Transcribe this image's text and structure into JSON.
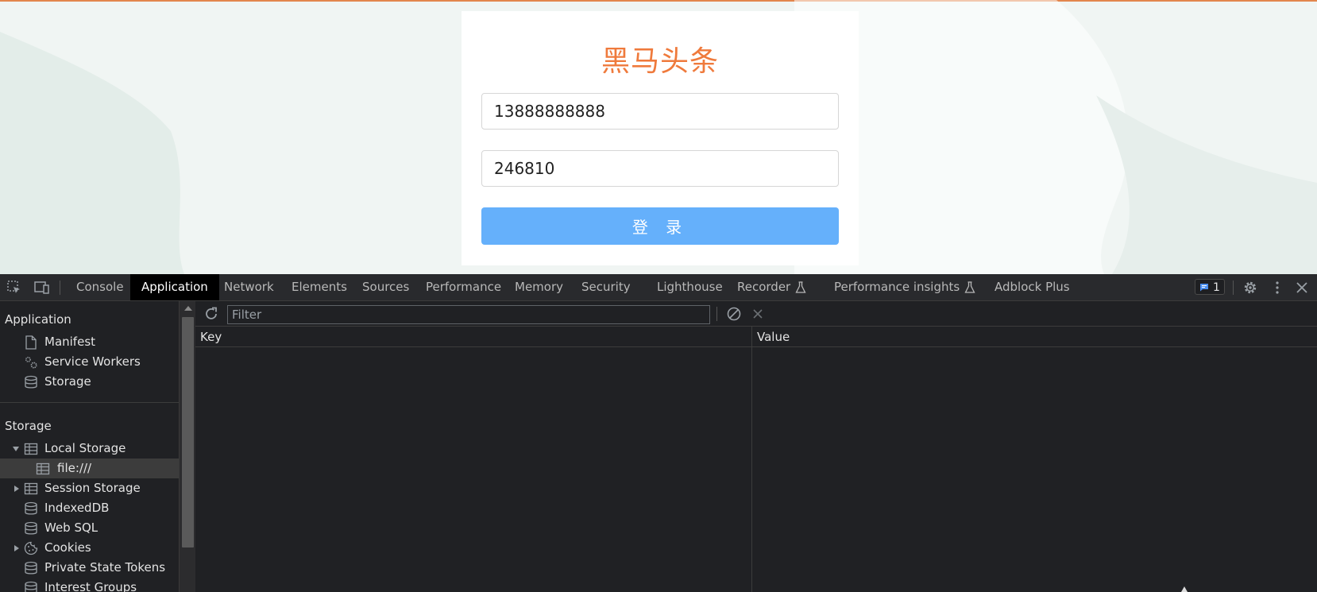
{
  "page": {
    "brand_color": "#ef7a3c",
    "title": "黑马头条",
    "phone_value": "13888888888",
    "code_value": "246810",
    "login_label": "登 录",
    "login_button_color": "#65b0fb"
  },
  "devtools": {
    "tabs": [
      {
        "label": "Console"
      },
      {
        "label": "Application"
      },
      {
        "label": "Network"
      },
      {
        "label": "Elements"
      },
      {
        "label": "Sources"
      },
      {
        "label": "Performance"
      },
      {
        "label": "Memory"
      },
      {
        "label": "Security"
      },
      {
        "label": "Lighthouse"
      },
      {
        "label": "Recorder"
      },
      {
        "label": "Performance insights"
      },
      {
        "label": "Adblock Plus"
      }
    ],
    "active_tab": "Application",
    "issues_count": "1",
    "icons": [
      "inspect-element-icon",
      "device-toolbar-icon",
      "flask-icon",
      "issues-icon",
      "settings-gear-icon",
      "more-vert-icon",
      "close-icon"
    ],
    "sidebar": {
      "app_header": "Application",
      "app_items": [
        {
          "label": "Manifest",
          "icon": "document-icon"
        },
        {
          "label": "Service Workers",
          "icon": "gears-icon"
        },
        {
          "label": "Storage",
          "icon": "database-icon"
        }
      ],
      "storage_header": "Storage",
      "storage_items": [
        {
          "label": "Local Storage",
          "icon": "table-icon",
          "expanded": true
        },
        {
          "label": "file:///",
          "icon": "table-icon",
          "selected": true
        },
        {
          "label": "Session Storage",
          "icon": "table-icon",
          "expanded": false
        },
        {
          "label": "IndexedDB",
          "icon": "database-icon"
        },
        {
          "label": "Web SQL",
          "icon": "database-icon"
        },
        {
          "label": "Cookies",
          "icon": "cookie-icon",
          "expanded": false
        },
        {
          "label": "Private State Tokens",
          "icon": "database-icon"
        },
        {
          "label": "Interest Groups",
          "icon": "database-icon"
        }
      ]
    },
    "storage_pane": {
      "filter_placeholder": "Filter",
      "columns": [
        "Key",
        "Value"
      ]
    }
  }
}
